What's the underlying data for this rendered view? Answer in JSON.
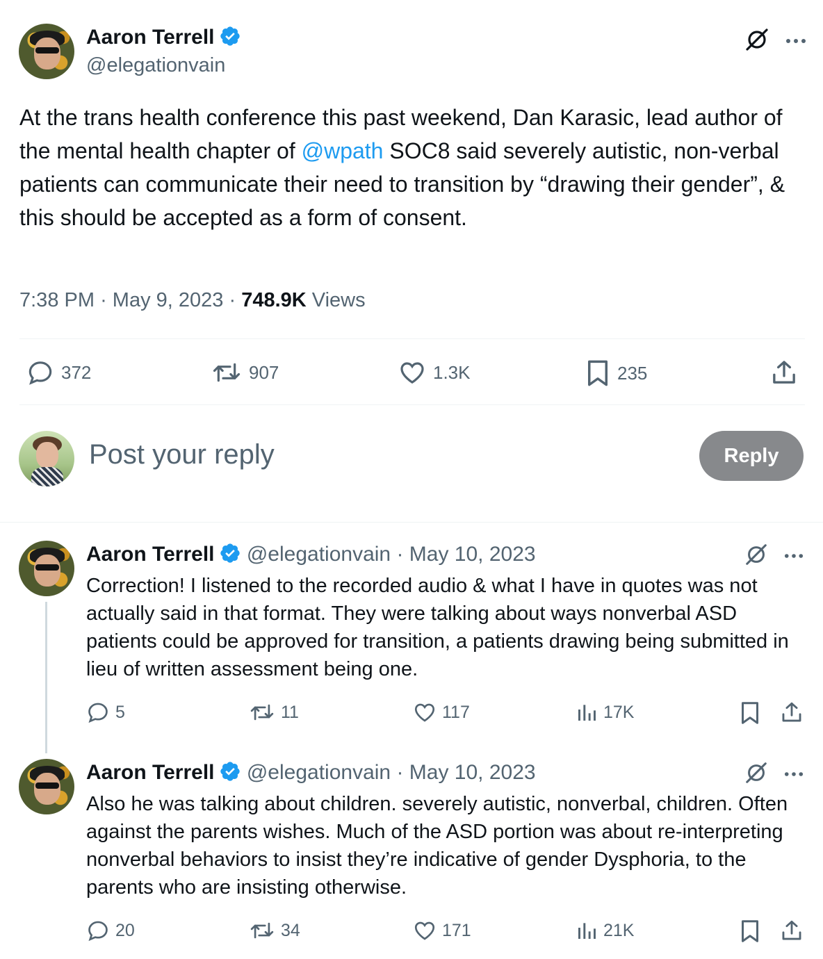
{
  "main_post": {
    "author_name": "Aaron Terrell",
    "handle": "@elegationvain",
    "text_before_mention": "At the trans health conference this past weekend, Dan Karasic, lead author of the mental health chapter of ",
    "mention": "@wpath",
    "text_after_mention": " SOC8 said severely autistic, non-verbal patients can communicate their need to transition by “drawing their gender”, & this should be accepted as a form of consent.",
    "time": "7:38 PM",
    "date": "May 9, 2023",
    "separator": "·",
    "views_count": "748.9K",
    "views_label": "Views",
    "replies": "372",
    "reposts": "907",
    "likes": "1.3K",
    "bookmarks": "235"
  },
  "reply_box": {
    "placeholder": "Post your reply",
    "button_label": "Reply"
  },
  "replies": [
    {
      "author_name": "Aaron Terrell",
      "handle": "@elegationvain",
      "date": "· May 10, 2023",
      "text": "Correction! I listened to the recorded audio & what I have in quotes was not actually said in that format. They were talking about ways nonverbal ASD patients could be approved for transition, a patients drawing being submitted in lieu of written assessment being one.",
      "replies": "5",
      "reposts": "11",
      "likes": "117",
      "views": "17K"
    },
    {
      "author_name": "Aaron Terrell",
      "handle": "@elegationvain",
      "date": "· May 10, 2023",
      "text": "Also he was talking about children. severely autistic, nonverbal, children. Often against the parents wishes. Much of the ASD portion was about re-interpreting nonverbal behaviors to insist they’re indicative of gender Dysphoria, to the parents who are insisting otherwise.",
      "replies": "20",
      "reposts": "34",
      "likes": "171",
      "views": "21K"
    }
  ],
  "colors": {
    "text": "#0f1419",
    "muted": "#536471",
    "link": "#1d9bf0",
    "verified": "#1d9bf0",
    "divider": "#eff3f4",
    "reply_button_disabled": "#87898c"
  }
}
